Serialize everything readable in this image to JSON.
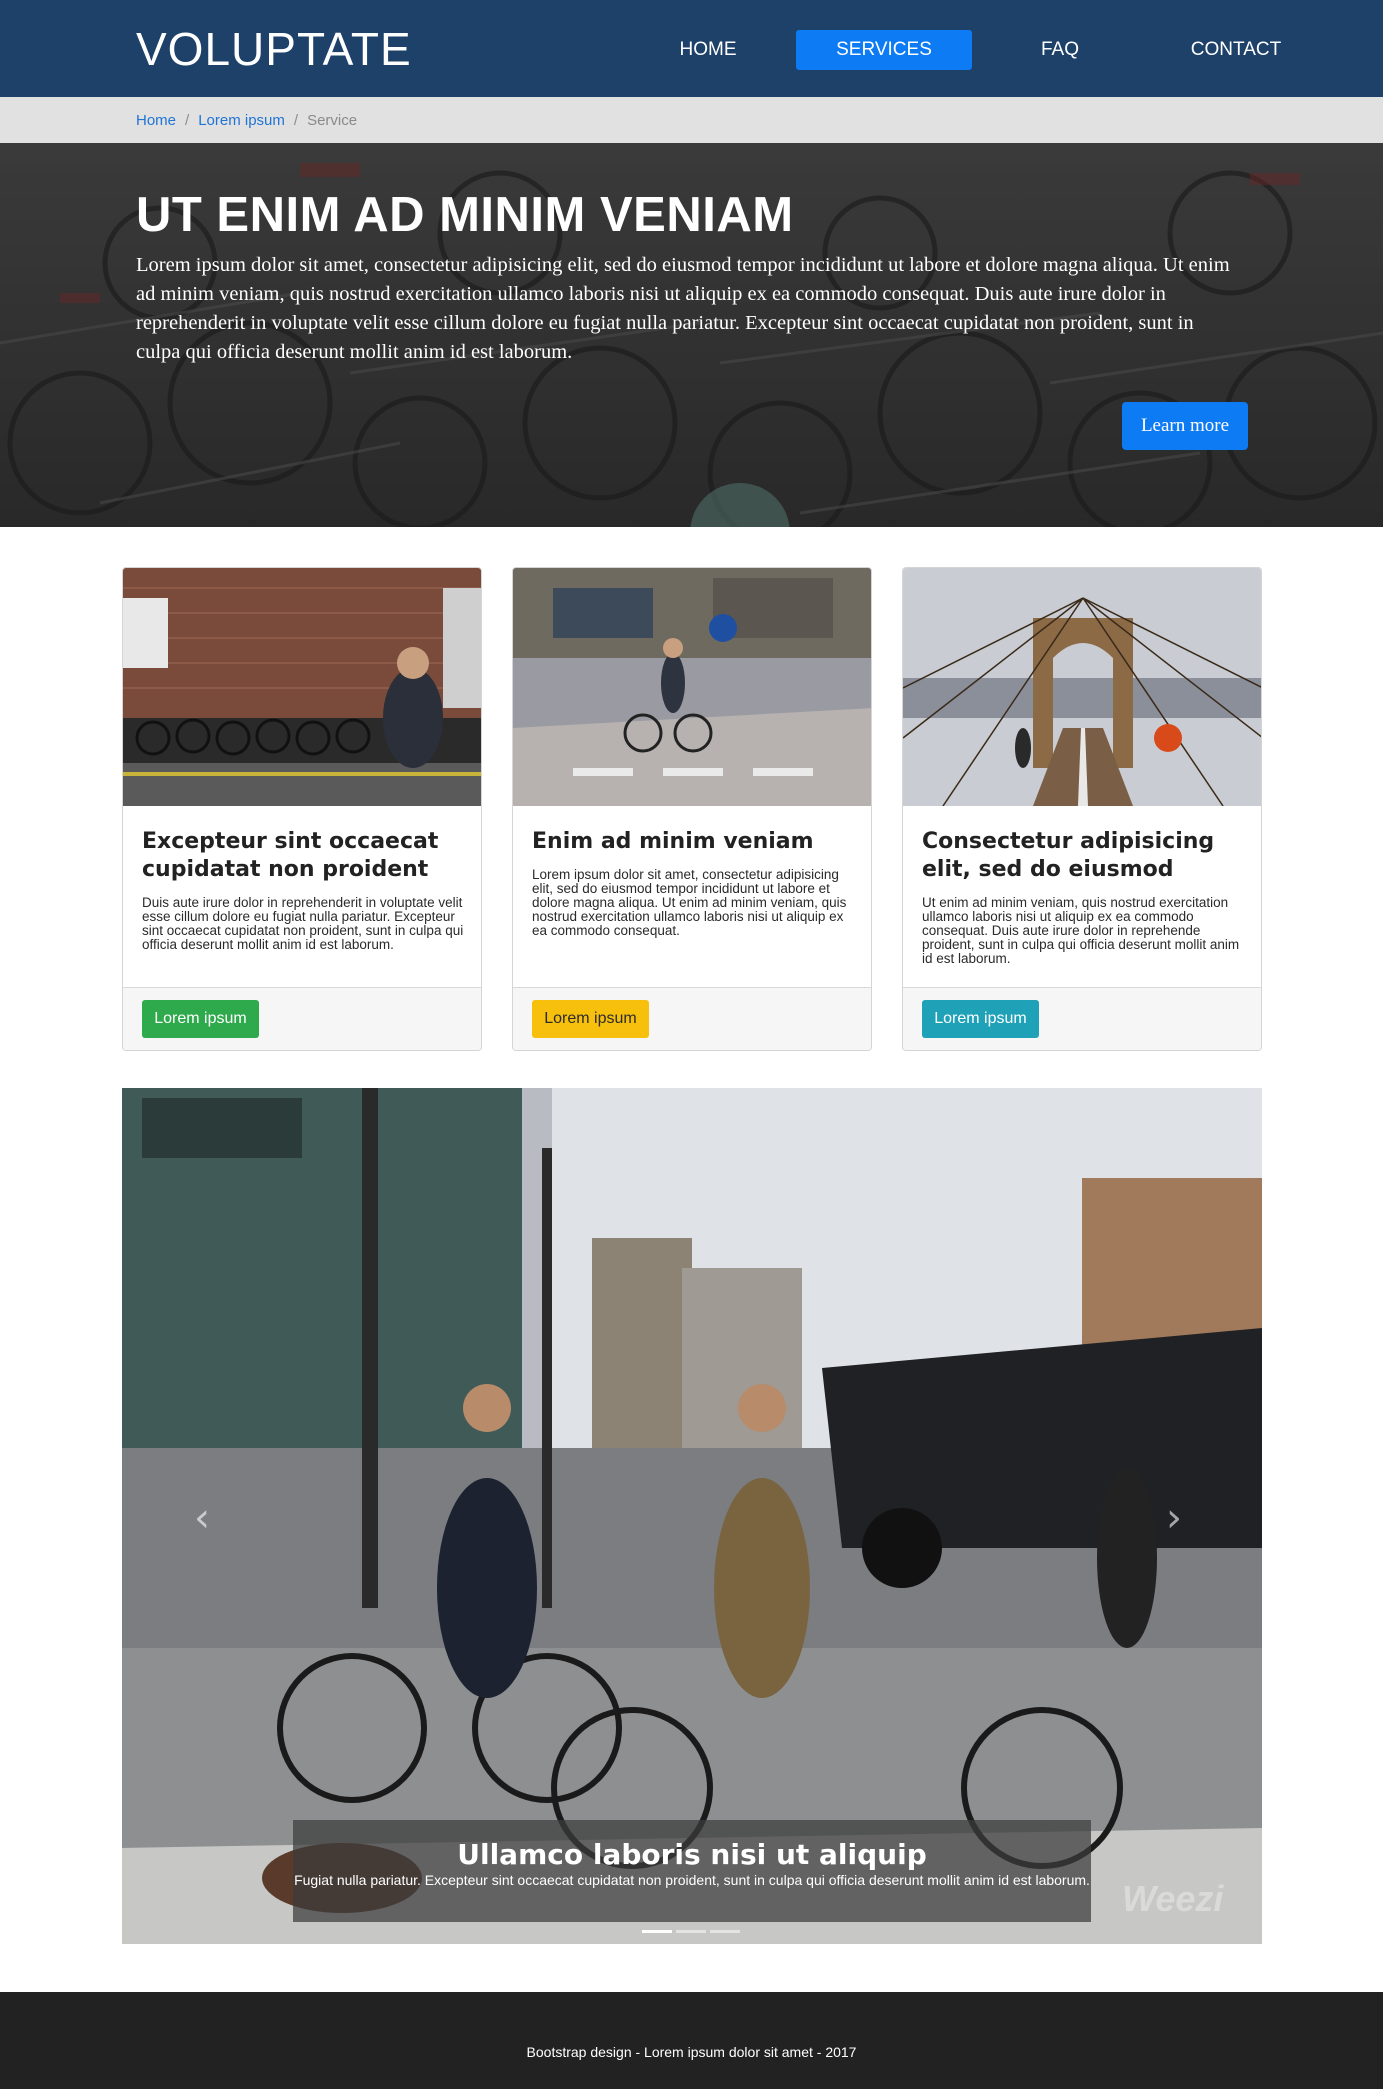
{
  "navbar": {
    "brand": "VOLUPTATE",
    "items": [
      {
        "label": "HOME",
        "active": false
      },
      {
        "label": "SERVICES",
        "active": true
      },
      {
        "label": "FAQ",
        "active": false
      },
      {
        "label": "CONTACT",
        "active": false
      }
    ]
  },
  "breadcrumb": {
    "items": [
      "Home",
      "Lorem ipsum"
    ],
    "current": "Service",
    "separator": "/"
  },
  "hero": {
    "title": "UT ENIM AD MINIM VENIAM",
    "text": "Lorem ipsum dolor sit amet, consectetur adipisicing elit, sed do eiusmod tempor incididunt ut labore et dolore magna aliqua. Ut enim ad minim veniam, quis nostrud exercitation ullamco laboris nisi ut aliquip ex ea commodo consequat. Duis aute irure dolor in reprehenderit in voluptate velit esse cillum dolore eu fugiat nulla pariatur. Excepteur sint occaecat cupidatat non proident, sunt in culpa qui officia deserunt mollit anim id est laborum.",
    "button_label": "Learn more"
  },
  "cards": [
    {
      "title": "Excepteur sint occaecat cupidatat non proident",
      "text": "Duis aute irure dolor in reprehenderit in voluptate velit esse cillum dolore eu fugiat nulla pariatur. Excepteur sint occaecat cupidatat non proident, sunt in culpa qui officia deserunt mollit anim id est laborum.",
      "button_label": "Lorem ipsum",
      "button_color": "#2ea94b"
    },
    {
      "title": "Enim ad minim veniam",
      "text": "Lorem ipsum dolor sit amet, consectetur adipisicing elit, sed do eiusmod tempor incididunt ut labore et dolore magna aliqua. Ut enim ad minim veniam, quis nostrud exercitation ullamco laboris nisi ut aliquip ex ea commodo consequat.",
      "button_label": "Lorem ipsum",
      "button_color": "#f7c00d"
    },
    {
      "title": "Consectetur adipisicing elit, sed do eiusmod",
      "text": "Ut enim ad minim veniam, quis nostrud exercitation ullamco laboris nisi ut aliquip ex ea commodo consequat. Duis aute irure dolor in reprehende proident, sunt in culpa qui officia deserunt mollit anim id est laborum.",
      "button_label": "Lorem ipsum",
      "button_color": "#1fa1b8"
    }
  ],
  "carousel": {
    "caption_title": "Ullamco laboris nisi ut aliquip",
    "caption_text": "Fugiat nulla pariatur. Excepteur sint occaecat cupidatat non proident, sunt in culpa qui officia deserunt mollit anim id est laborum.",
    "prev_icon": "chevron-left-icon",
    "next_icon": "chevron-right-icon",
    "indicator_count": 3,
    "active_indicator": 0,
    "watermark": "Weezi"
  },
  "footer": {
    "text": "Bootstrap design - Lorem ipsum dolor sit amet - 2017"
  },
  "colors": {
    "navbar_bg": "#1e416a",
    "accent": "#0d7bf3",
    "footer_bg": "#222222"
  }
}
